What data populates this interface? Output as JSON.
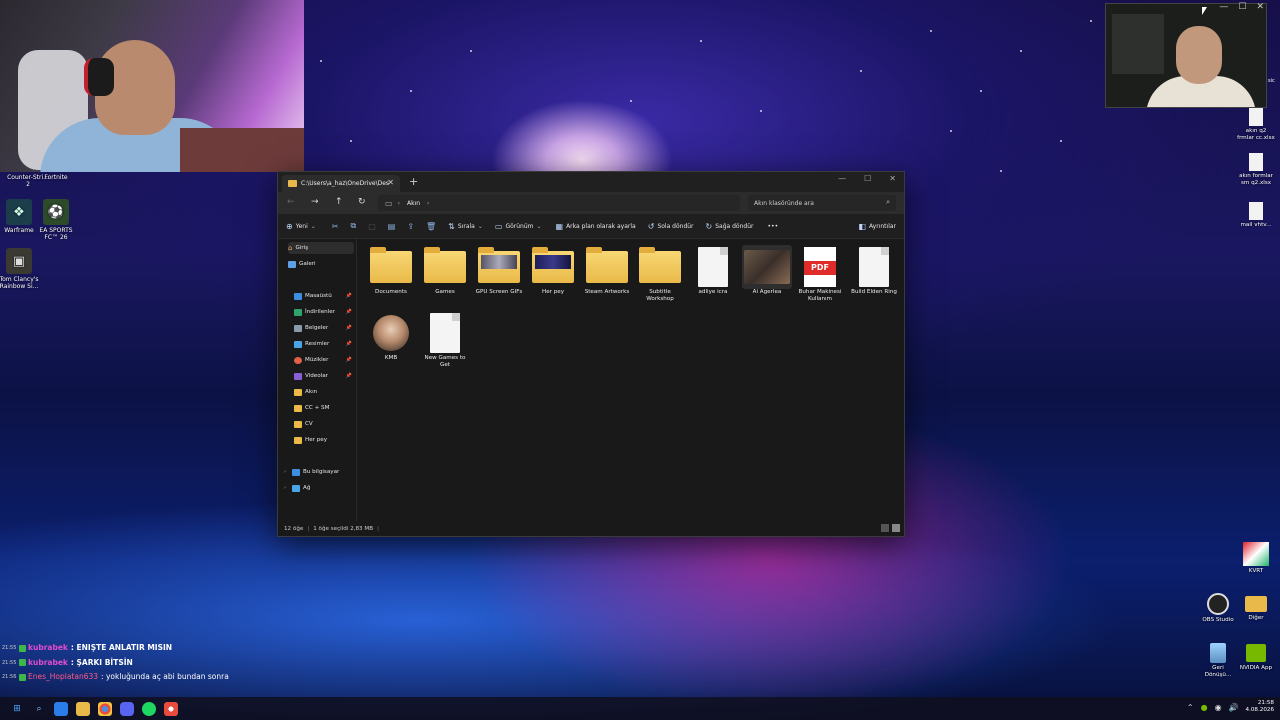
{
  "desktop": {
    "left_icons": [
      {
        "label": "Counter-Stri...\n2"
      },
      {
        "label": "Fortnite"
      },
      {
        "label": "Warframe"
      },
      {
        "label": "EA SPORTS\nFC™ 26"
      },
      {
        "label": "Tom Clancy's\nRainbow Si..."
      }
    ],
    "right_icons": [
      {
        "label": "akın q2\nfrmlar cc.xlsx"
      },
      {
        "label": "akın formlar\nsm q2.xlsx"
      },
      {
        "label": "mail vhtv..."
      },
      {
        "label": "KVRT"
      },
      {
        "label": "OBS Studio"
      },
      {
        "label": "Diğer"
      },
      {
        "label": "Geri\nDönüşü..."
      },
      {
        "label": "NVIDIA App"
      }
    ],
    "partial_label": "sic"
  },
  "explorer": {
    "tab_title": "C:\\Users\\a_haz\\OneDrive\\Des",
    "tab_close": "✕",
    "tab_add": "+",
    "window_controls": [
      "—",
      "☐",
      "✕"
    ],
    "address": {
      "path_segment": "Akın",
      "separator": "›"
    },
    "search": {
      "placeholder": "Akın klasöründe ara"
    },
    "commands": {
      "new": "Yeni",
      "sort": "Sırala",
      "view": "Görünüm",
      "set_background": "Arka plan olarak ayarla",
      "rotate_left": "Sola döndür",
      "rotate_right": "Sağa döndür",
      "more": "•••",
      "details": "Ayrıntılar"
    },
    "sidebar": [
      {
        "label": "Giriş"
      },
      {
        "label": "Galeri"
      },
      {
        "label": "Masaüstü"
      },
      {
        "label": "İndirilenler"
      },
      {
        "label": "Belgeler"
      },
      {
        "label": "Resimler"
      },
      {
        "label": "Müzikler"
      },
      {
        "label": "Videolar"
      },
      {
        "label": "Akın"
      },
      {
        "label": "CC + SM"
      },
      {
        "label": "CV"
      },
      {
        "label": "Her pey"
      },
      {
        "label": "Bu bilgisayar"
      },
      {
        "label": "Ağ"
      }
    ],
    "files": [
      {
        "name": "Documents",
        "type": "folder"
      },
      {
        "name": "Games",
        "type": "folder"
      },
      {
        "name": "GPU Screen GIFs",
        "type": "folder-preview"
      },
      {
        "name": "Her pey",
        "type": "folder-preview-dark"
      },
      {
        "name": "Steam Artworks",
        "type": "folder"
      },
      {
        "name": "Subtitle\nWorkshop",
        "type": "folder"
      },
      {
        "name": "adliye icra",
        "type": "doc"
      },
      {
        "name": "Ai Agerlea",
        "type": "photo"
      },
      {
        "name": "Buhar Makinesi\nKullanım",
        "type": "pdf"
      },
      {
        "name": "Build Elden Ring",
        "type": "doc"
      },
      {
        "name": "KMB",
        "type": "avatar"
      },
      {
        "name": "New Games to\nGet",
        "type": "doc"
      }
    ],
    "status": {
      "count": "12 öğe",
      "selection": "1 öğe seçildi  2,83 MB"
    }
  },
  "chat": [
    {
      "time": "21:55",
      "user": "kubrabek",
      "message": ": ENIŞTE ANLATIR MISIN"
    },
    {
      "time": "21:55",
      "user": "kubrabek",
      "message": ": ŞARKI BİTSİN"
    },
    {
      "time": "21:56",
      "user": "Enes_Hoplatan633",
      "message": ": yokluğunda aç abi bundan sonra"
    }
  ],
  "taskbar": {
    "clock_time": "21:58",
    "clock_date": "4.08.2026"
  },
  "colors": {
    "folder": "#e9b949",
    "explorer_bg": "#191919",
    "chat_user": "#e34bd0"
  }
}
